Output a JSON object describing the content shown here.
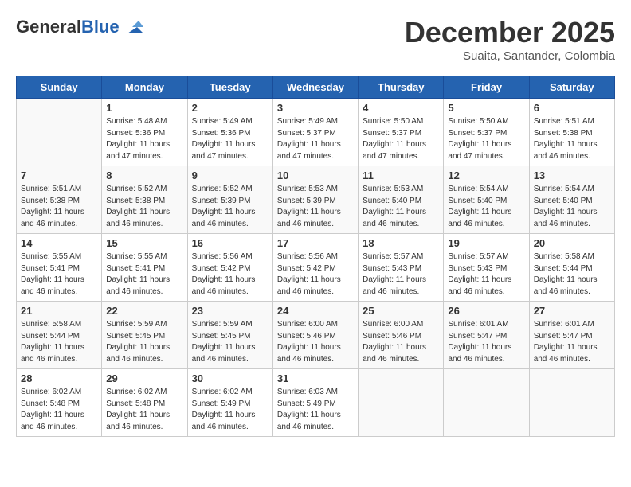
{
  "header": {
    "logo_line1": "General",
    "logo_line2": "Blue",
    "month": "December 2025",
    "location": "Suaita, Santander, Colombia"
  },
  "weekdays": [
    "Sunday",
    "Monday",
    "Tuesday",
    "Wednesday",
    "Thursday",
    "Friday",
    "Saturday"
  ],
  "weeks": [
    [
      {
        "day": "",
        "detail": ""
      },
      {
        "day": "1",
        "detail": "Sunrise: 5:48 AM\nSunset: 5:36 PM\nDaylight: 11 hours\nand 47 minutes."
      },
      {
        "day": "2",
        "detail": "Sunrise: 5:49 AM\nSunset: 5:36 PM\nDaylight: 11 hours\nand 47 minutes."
      },
      {
        "day": "3",
        "detail": "Sunrise: 5:49 AM\nSunset: 5:37 PM\nDaylight: 11 hours\nand 47 minutes."
      },
      {
        "day": "4",
        "detail": "Sunrise: 5:50 AM\nSunset: 5:37 PM\nDaylight: 11 hours\nand 47 minutes."
      },
      {
        "day": "5",
        "detail": "Sunrise: 5:50 AM\nSunset: 5:37 PM\nDaylight: 11 hours\nand 47 minutes."
      },
      {
        "day": "6",
        "detail": "Sunrise: 5:51 AM\nSunset: 5:38 PM\nDaylight: 11 hours\nand 46 minutes."
      }
    ],
    [
      {
        "day": "7",
        "detail": "Sunrise: 5:51 AM\nSunset: 5:38 PM\nDaylight: 11 hours\nand 46 minutes."
      },
      {
        "day": "8",
        "detail": "Sunrise: 5:52 AM\nSunset: 5:38 PM\nDaylight: 11 hours\nand 46 minutes."
      },
      {
        "day": "9",
        "detail": "Sunrise: 5:52 AM\nSunset: 5:39 PM\nDaylight: 11 hours\nand 46 minutes."
      },
      {
        "day": "10",
        "detail": "Sunrise: 5:53 AM\nSunset: 5:39 PM\nDaylight: 11 hours\nand 46 minutes."
      },
      {
        "day": "11",
        "detail": "Sunrise: 5:53 AM\nSunset: 5:40 PM\nDaylight: 11 hours\nand 46 minutes."
      },
      {
        "day": "12",
        "detail": "Sunrise: 5:54 AM\nSunset: 5:40 PM\nDaylight: 11 hours\nand 46 minutes."
      },
      {
        "day": "13",
        "detail": "Sunrise: 5:54 AM\nSunset: 5:40 PM\nDaylight: 11 hours\nand 46 minutes."
      }
    ],
    [
      {
        "day": "14",
        "detail": "Sunrise: 5:55 AM\nSunset: 5:41 PM\nDaylight: 11 hours\nand 46 minutes."
      },
      {
        "day": "15",
        "detail": "Sunrise: 5:55 AM\nSunset: 5:41 PM\nDaylight: 11 hours\nand 46 minutes."
      },
      {
        "day": "16",
        "detail": "Sunrise: 5:56 AM\nSunset: 5:42 PM\nDaylight: 11 hours\nand 46 minutes."
      },
      {
        "day": "17",
        "detail": "Sunrise: 5:56 AM\nSunset: 5:42 PM\nDaylight: 11 hours\nand 46 minutes."
      },
      {
        "day": "18",
        "detail": "Sunrise: 5:57 AM\nSunset: 5:43 PM\nDaylight: 11 hours\nand 46 minutes."
      },
      {
        "day": "19",
        "detail": "Sunrise: 5:57 AM\nSunset: 5:43 PM\nDaylight: 11 hours\nand 46 minutes."
      },
      {
        "day": "20",
        "detail": "Sunrise: 5:58 AM\nSunset: 5:44 PM\nDaylight: 11 hours\nand 46 minutes."
      }
    ],
    [
      {
        "day": "21",
        "detail": "Sunrise: 5:58 AM\nSunset: 5:44 PM\nDaylight: 11 hours\nand 46 minutes."
      },
      {
        "day": "22",
        "detail": "Sunrise: 5:59 AM\nSunset: 5:45 PM\nDaylight: 11 hours\nand 46 minutes."
      },
      {
        "day": "23",
        "detail": "Sunrise: 5:59 AM\nSunset: 5:45 PM\nDaylight: 11 hours\nand 46 minutes."
      },
      {
        "day": "24",
        "detail": "Sunrise: 6:00 AM\nSunset: 5:46 PM\nDaylight: 11 hours\nand 46 minutes."
      },
      {
        "day": "25",
        "detail": "Sunrise: 6:00 AM\nSunset: 5:46 PM\nDaylight: 11 hours\nand 46 minutes."
      },
      {
        "day": "26",
        "detail": "Sunrise: 6:01 AM\nSunset: 5:47 PM\nDaylight: 11 hours\nand 46 minutes."
      },
      {
        "day": "27",
        "detail": "Sunrise: 6:01 AM\nSunset: 5:47 PM\nDaylight: 11 hours\nand 46 minutes."
      }
    ],
    [
      {
        "day": "28",
        "detail": "Sunrise: 6:02 AM\nSunset: 5:48 PM\nDaylight: 11 hours\nand 46 minutes."
      },
      {
        "day": "29",
        "detail": "Sunrise: 6:02 AM\nSunset: 5:48 PM\nDaylight: 11 hours\nand 46 minutes."
      },
      {
        "day": "30",
        "detail": "Sunrise: 6:02 AM\nSunset: 5:49 PM\nDaylight: 11 hours\nand 46 minutes."
      },
      {
        "day": "31",
        "detail": "Sunrise: 6:03 AM\nSunset: 5:49 PM\nDaylight: 11 hours\nand 46 minutes."
      },
      {
        "day": "",
        "detail": ""
      },
      {
        "day": "",
        "detail": ""
      },
      {
        "day": "",
        "detail": ""
      }
    ]
  ]
}
